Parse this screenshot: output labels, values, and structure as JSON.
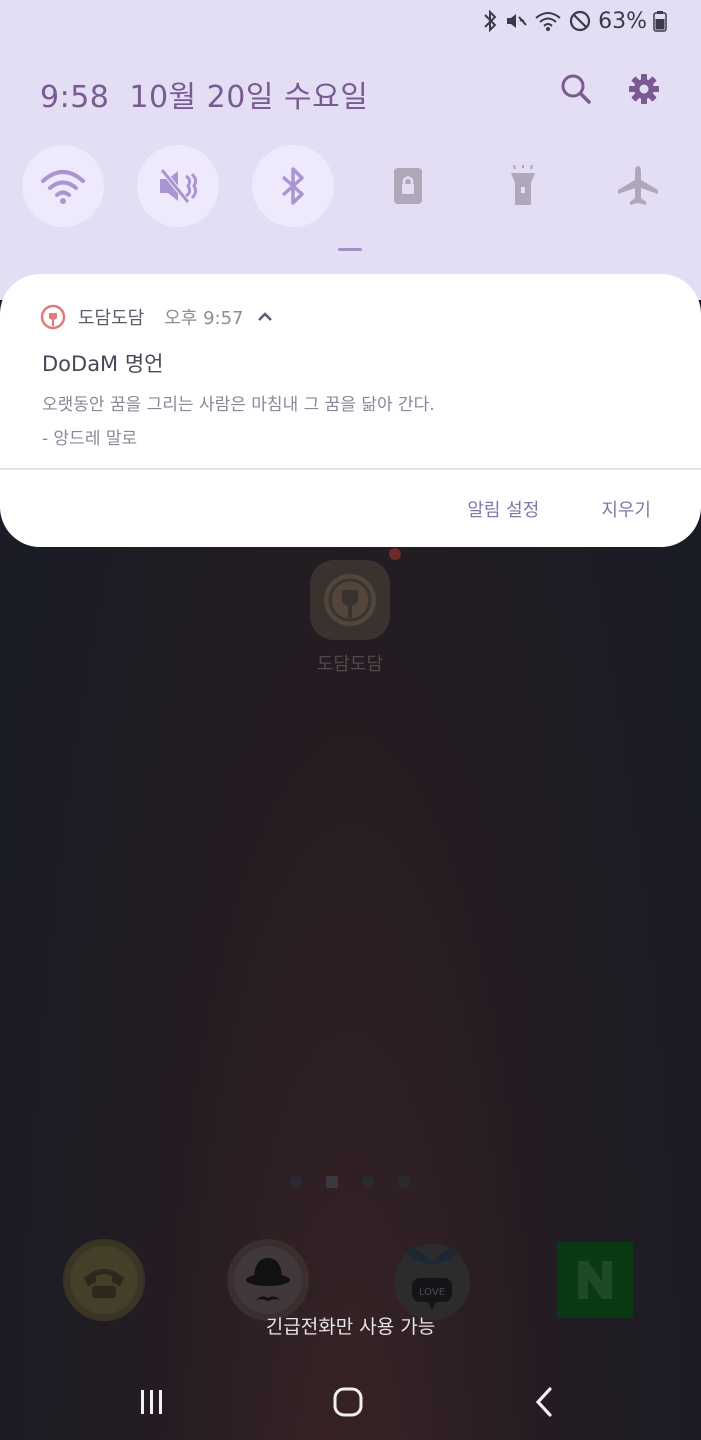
{
  "status_bar": {
    "battery_percent_text": "63%",
    "icons": [
      "bluetooth-icon",
      "mute-icon",
      "wifi-icon",
      "do-not-disturb-icon",
      "battery-icon"
    ]
  },
  "panel": {
    "time": "9:58",
    "date": "10월 20일 수요일",
    "actions": [
      "search-icon",
      "settings-gear-icon"
    ],
    "quick_tiles": [
      {
        "name": "wifi",
        "on": true
      },
      {
        "name": "sound-mute",
        "on": true
      },
      {
        "name": "bluetooth",
        "on": true
      },
      {
        "name": "screen-lock",
        "on": false
      },
      {
        "name": "flashlight",
        "on": false
      },
      {
        "name": "airplane-mode",
        "on": false
      }
    ]
  },
  "notification": {
    "app_name": "도담도담",
    "time": "오후 9:57",
    "title": "DoDaM 명언",
    "body_line1": "오랫동안 꿈을 그리는 사람은 마침내 그 꿈을 닮아 간다.",
    "body_line2": "- 앙드레 말로",
    "action_settings": "알림 설정",
    "action_clear": "지우기"
  },
  "home": {
    "app_label": "도담도담",
    "emergency_text": "긴급전화만 사용 가능",
    "dock_icons": [
      "phone-icon",
      "contacts-hat-icon",
      "messages-love-icon",
      "naver-n-icon"
    ]
  },
  "colors": {
    "panel_bg": "#e3def4",
    "accent": "#7a5a93",
    "tile_on": "#eeeafc"
  }
}
